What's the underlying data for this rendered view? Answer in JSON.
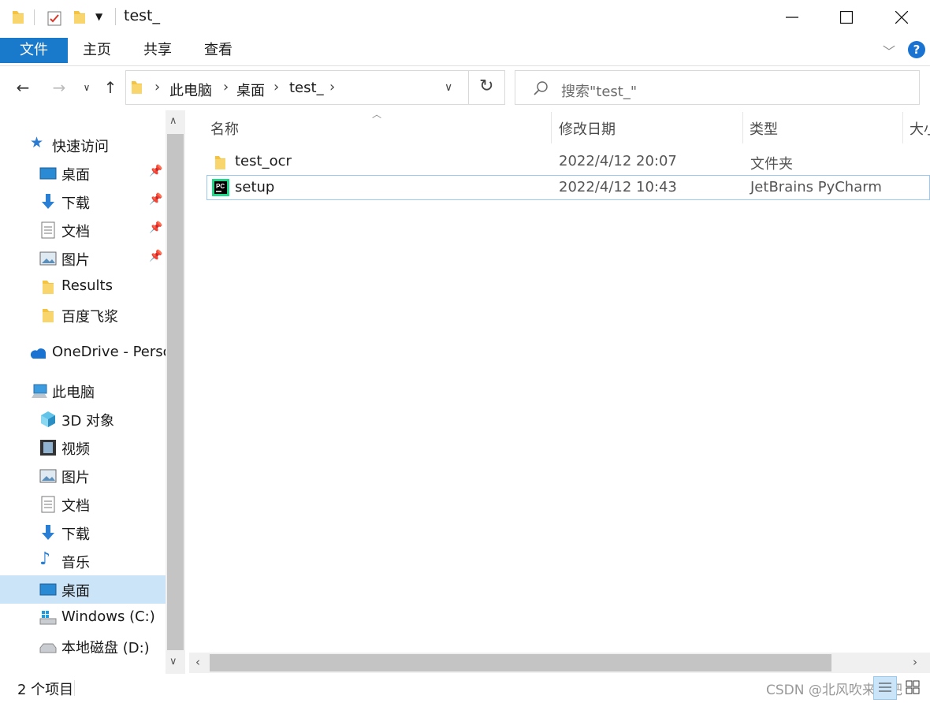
{
  "window": {
    "title": "test_",
    "colors": {
      "accent": "#1979ca",
      "selection": "#cce4f7",
      "help": "#1a73d1"
    }
  },
  "ribbon": {
    "tabs": [
      "文件",
      "主页",
      "共享",
      "查看"
    ]
  },
  "address": {
    "crumbs": [
      "此电脑",
      "桌面",
      "test_"
    ],
    "search_placeholder": "搜索\"test_\""
  },
  "nav": {
    "quick_access": "快速访问",
    "quick_items": [
      {
        "label": "桌面",
        "icon": "desktop-icon",
        "pinned": true
      },
      {
        "label": "下载",
        "icon": "download-icon",
        "pinned": true
      },
      {
        "label": "文档",
        "icon": "document-icon",
        "pinned": true
      },
      {
        "label": "图片",
        "icon": "pictures-icon",
        "pinned": true
      },
      {
        "label": "Results",
        "icon": "folder-icon",
        "pinned": false
      },
      {
        "label": "百度飞浆",
        "icon": "folder-icon",
        "pinned": false
      }
    ],
    "onedrive": "OneDrive - Perso",
    "this_pc": "此电脑",
    "pc_items": [
      {
        "label": "3D 对象",
        "icon": "3d-objects-icon"
      },
      {
        "label": "视频",
        "icon": "video-icon"
      },
      {
        "label": "图片",
        "icon": "pictures-icon"
      },
      {
        "label": "文档",
        "icon": "document-icon"
      },
      {
        "label": "下载",
        "icon": "download-icon"
      },
      {
        "label": "音乐",
        "icon": "music-icon"
      },
      {
        "label": "桌面",
        "icon": "desktop-icon",
        "selected": true
      },
      {
        "label": "Windows  (C:)",
        "icon": "windows-drive-icon"
      },
      {
        "label": "本地磁盘 (D:)",
        "icon": "drive-icon"
      }
    ]
  },
  "columns": [
    "名称",
    "修改日期",
    "类型",
    "大小"
  ],
  "files": [
    {
      "name": "test_ocr",
      "date": "2022/4/12 20:07",
      "type": "文件夹",
      "icon": "folder-icon"
    },
    {
      "name": "setup",
      "date": "2022/4/12 10:43",
      "type": "JetBrains PyCharm",
      "icon": "pycharm-icon"
    }
  ],
  "status": {
    "count": "2 个项目",
    "watermark": "CSDN @北风吹来个吧"
  }
}
